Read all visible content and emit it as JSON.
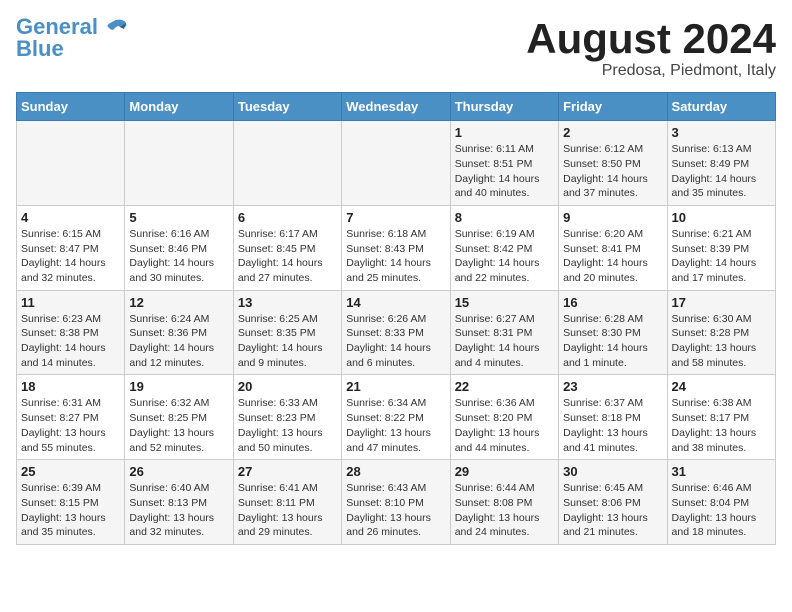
{
  "header": {
    "logo_line1": "General",
    "logo_line2": "Blue",
    "month_title": "August 2024",
    "location": "Predosa, Piedmont, Italy"
  },
  "days_of_week": [
    "Sunday",
    "Monday",
    "Tuesday",
    "Wednesday",
    "Thursday",
    "Friday",
    "Saturday"
  ],
  "weeks": [
    [
      {
        "day": "",
        "info": ""
      },
      {
        "day": "",
        "info": ""
      },
      {
        "day": "",
        "info": ""
      },
      {
        "day": "",
        "info": ""
      },
      {
        "day": "1",
        "info": "Sunrise: 6:11 AM\nSunset: 8:51 PM\nDaylight: 14 hours\nand 40 minutes."
      },
      {
        "day": "2",
        "info": "Sunrise: 6:12 AM\nSunset: 8:50 PM\nDaylight: 14 hours\nand 37 minutes."
      },
      {
        "day": "3",
        "info": "Sunrise: 6:13 AM\nSunset: 8:49 PM\nDaylight: 14 hours\nand 35 minutes."
      }
    ],
    [
      {
        "day": "4",
        "info": "Sunrise: 6:15 AM\nSunset: 8:47 PM\nDaylight: 14 hours\nand 32 minutes."
      },
      {
        "day": "5",
        "info": "Sunrise: 6:16 AM\nSunset: 8:46 PM\nDaylight: 14 hours\nand 30 minutes."
      },
      {
        "day": "6",
        "info": "Sunrise: 6:17 AM\nSunset: 8:45 PM\nDaylight: 14 hours\nand 27 minutes."
      },
      {
        "day": "7",
        "info": "Sunrise: 6:18 AM\nSunset: 8:43 PM\nDaylight: 14 hours\nand 25 minutes."
      },
      {
        "day": "8",
        "info": "Sunrise: 6:19 AM\nSunset: 8:42 PM\nDaylight: 14 hours\nand 22 minutes."
      },
      {
        "day": "9",
        "info": "Sunrise: 6:20 AM\nSunset: 8:41 PM\nDaylight: 14 hours\nand 20 minutes."
      },
      {
        "day": "10",
        "info": "Sunrise: 6:21 AM\nSunset: 8:39 PM\nDaylight: 14 hours\nand 17 minutes."
      }
    ],
    [
      {
        "day": "11",
        "info": "Sunrise: 6:23 AM\nSunset: 8:38 PM\nDaylight: 14 hours\nand 14 minutes."
      },
      {
        "day": "12",
        "info": "Sunrise: 6:24 AM\nSunset: 8:36 PM\nDaylight: 14 hours\nand 12 minutes."
      },
      {
        "day": "13",
        "info": "Sunrise: 6:25 AM\nSunset: 8:35 PM\nDaylight: 14 hours\nand 9 minutes."
      },
      {
        "day": "14",
        "info": "Sunrise: 6:26 AM\nSunset: 8:33 PM\nDaylight: 14 hours\nand 6 minutes."
      },
      {
        "day": "15",
        "info": "Sunrise: 6:27 AM\nSunset: 8:31 PM\nDaylight: 14 hours\nand 4 minutes."
      },
      {
        "day": "16",
        "info": "Sunrise: 6:28 AM\nSunset: 8:30 PM\nDaylight: 14 hours\nand 1 minute."
      },
      {
        "day": "17",
        "info": "Sunrise: 6:30 AM\nSunset: 8:28 PM\nDaylight: 13 hours\nand 58 minutes."
      }
    ],
    [
      {
        "day": "18",
        "info": "Sunrise: 6:31 AM\nSunset: 8:27 PM\nDaylight: 13 hours\nand 55 minutes."
      },
      {
        "day": "19",
        "info": "Sunrise: 6:32 AM\nSunset: 8:25 PM\nDaylight: 13 hours\nand 52 minutes."
      },
      {
        "day": "20",
        "info": "Sunrise: 6:33 AM\nSunset: 8:23 PM\nDaylight: 13 hours\nand 50 minutes."
      },
      {
        "day": "21",
        "info": "Sunrise: 6:34 AM\nSunset: 8:22 PM\nDaylight: 13 hours\nand 47 minutes."
      },
      {
        "day": "22",
        "info": "Sunrise: 6:36 AM\nSunset: 8:20 PM\nDaylight: 13 hours\nand 44 minutes."
      },
      {
        "day": "23",
        "info": "Sunrise: 6:37 AM\nSunset: 8:18 PM\nDaylight: 13 hours\nand 41 minutes."
      },
      {
        "day": "24",
        "info": "Sunrise: 6:38 AM\nSunset: 8:17 PM\nDaylight: 13 hours\nand 38 minutes."
      }
    ],
    [
      {
        "day": "25",
        "info": "Sunrise: 6:39 AM\nSunset: 8:15 PM\nDaylight: 13 hours\nand 35 minutes."
      },
      {
        "day": "26",
        "info": "Sunrise: 6:40 AM\nSunset: 8:13 PM\nDaylight: 13 hours\nand 32 minutes."
      },
      {
        "day": "27",
        "info": "Sunrise: 6:41 AM\nSunset: 8:11 PM\nDaylight: 13 hours\nand 29 minutes."
      },
      {
        "day": "28",
        "info": "Sunrise: 6:43 AM\nSunset: 8:10 PM\nDaylight: 13 hours\nand 26 minutes."
      },
      {
        "day": "29",
        "info": "Sunrise: 6:44 AM\nSunset: 8:08 PM\nDaylight: 13 hours\nand 24 minutes."
      },
      {
        "day": "30",
        "info": "Sunrise: 6:45 AM\nSunset: 8:06 PM\nDaylight: 13 hours\nand 21 minutes."
      },
      {
        "day": "31",
        "info": "Sunrise: 6:46 AM\nSunset: 8:04 PM\nDaylight: 13 hours\nand 18 minutes."
      }
    ]
  ]
}
